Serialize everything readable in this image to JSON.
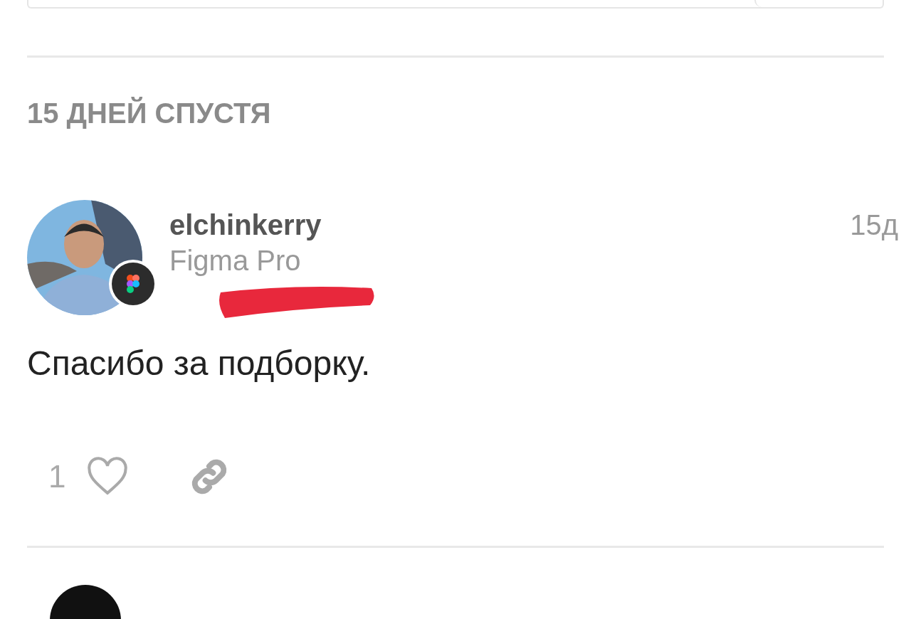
{
  "time_divider": {
    "label": "15 ДНЕЙ СПУСТЯ"
  },
  "post": {
    "author": "elchinkerry",
    "role": "Figma Pro",
    "time": "15д",
    "body": "Спасибо за подборку.",
    "like_count": "1",
    "liked": false,
    "redacted": true
  }
}
